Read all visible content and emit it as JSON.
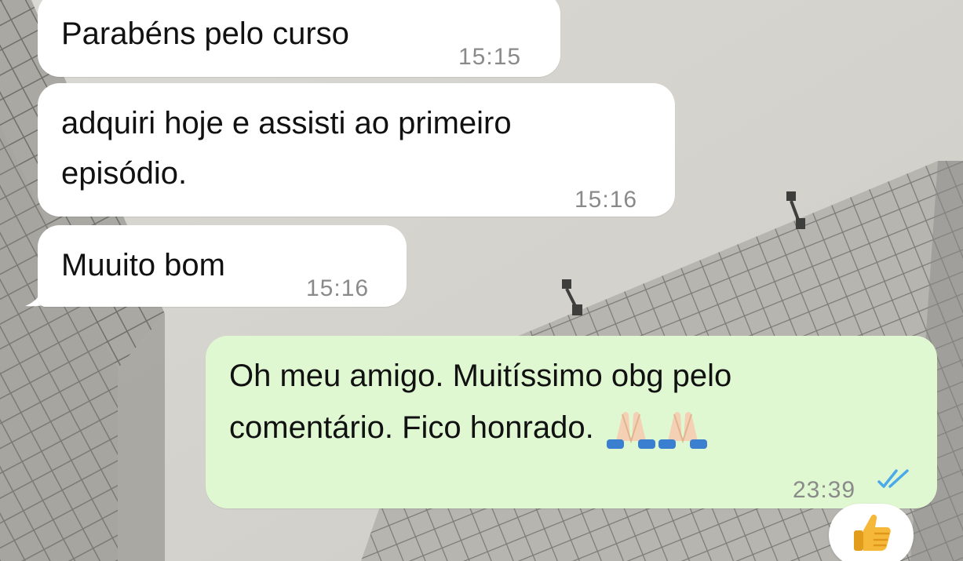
{
  "messages": [
    {
      "direction": "incoming",
      "text": "Parabéns pelo curso",
      "time": "15:15"
    },
    {
      "direction": "incoming",
      "text_lines": [
        "adquiri hoje e assisti ao primeiro",
        "episódio."
      ],
      "time": "15:16"
    },
    {
      "direction": "incoming",
      "text": "Muuito bom",
      "time": "15:16"
    },
    {
      "direction": "outgoing",
      "text_lines": [
        "Oh meu amigo. Muitíssimo obg pelo",
        "comentário. Fico honrado."
      ],
      "emoji": [
        "folded-hands-icon",
        "folded-hands-icon"
      ],
      "time": "23:39",
      "status": "read-double-check-icon"
    }
  ],
  "reaction": {
    "emoji": "thumbs-up-icon"
  },
  "colors": {
    "incoming_bubble": "#ffffff",
    "outgoing_bubble": "#e0f8d2",
    "read_ticks": "#4aa9e8",
    "timestamp": "#8a8a8a"
  }
}
